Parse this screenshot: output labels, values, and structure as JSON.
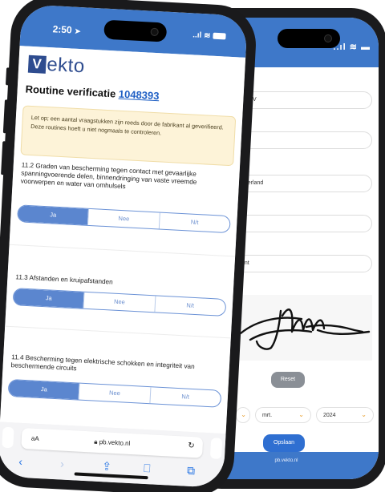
{
  "front": {
    "status": {
      "time": "2:50"
    },
    "logo_rest": "ekto",
    "logo_initial": "V",
    "heading": {
      "text": "Routine verificatie",
      "number": "1048393"
    },
    "notice": "Let op; een aantal vraagstukken zijn reeds door de fabrikant al geverifieerd. Deze routines hoeft u niet nogmaals te controleren.",
    "questions": [
      {
        "title": "11.2 Graden van bescherming tegen contact met gevaarlijke spanningvoerende delen, binnendringing van vaste vreemde voorwerpen en water van omhulsels",
        "options": [
          "Ja",
          "Nee",
          "N/t"
        ],
        "selected": 0
      },
      {
        "title": "11.3 Afstanden en kruipafstanden",
        "options": [
          "Ja",
          "Nee",
          "N/t"
        ],
        "selected": 0
      },
      {
        "title": "11.4 Bescherming tegen elektrische schokken en integriteit van beschermende circuits",
        "options": [
          "Ja",
          "Nee",
          "N/t"
        ],
        "selected": 0
      }
    ],
    "browser": {
      "aa": "aA",
      "url": "pb.vekto.nl"
    }
  },
  "back": {
    "field1": "rijf BV",
    "label1": "s",
    "field2": "ederland",
    "field4": "ent",
    "reset": "Reset",
    "month": "mrt.",
    "year": "2024",
    "save": "Opslaan",
    "url": "pb.vekto.nl"
  },
  "colors": {
    "brand": "#3e78c9",
    "logo": "#2e4c8f",
    "link": "#1f5fc4",
    "segment_on": "#5b86cf"
  }
}
